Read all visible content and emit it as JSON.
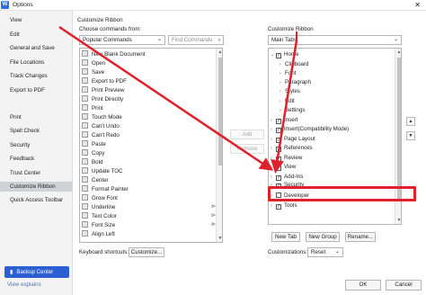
{
  "window": {
    "title": "Options",
    "logo": "W",
    "close_icon": "✕"
  },
  "sidebar": {
    "items": [
      {
        "label": "View"
      },
      {
        "label": "Edit"
      },
      {
        "label": "General and Save"
      },
      {
        "label": "File Locations"
      },
      {
        "label": "Track Changes"
      },
      {
        "label": "Export to PDF"
      },
      {
        "label": "Print"
      },
      {
        "label": "Spell Check"
      },
      {
        "label": "Security"
      },
      {
        "label": "Feedback"
      },
      {
        "label": "Trust Center"
      },
      {
        "label": "Customize Ribbon",
        "active": true
      },
      {
        "label": "Quick Access Toolbar"
      }
    ],
    "backup_label": "Backup Center",
    "view_explains": "View explains"
  },
  "left_panel": {
    "section_title": "Customize Ribbon",
    "choose_label": "Choose commands from:",
    "source_select": "Popular Commands",
    "search_placeholder": "Find Commands",
    "commands": [
      {
        "label": "New Blank Document",
        "icon": "new-doc-icon"
      },
      {
        "label": "Open",
        "icon": "open-icon"
      },
      {
        "label": "Save",
        "icon": "save-icon"
      },
      {
        "label": "Export to PDF",
        "icon": "pdf-icon"
      },
      {
        "label": "Print Preview",
        "icon": "print-preview-icon"
      },
      {
        "label": "Print  Directly",
        "icon": "print-directly-icon"
      },
      {
        "label": "Print",
        "icon": "print-icon"
      },
      {
        "label": "Touch Mode",
        "icon": "touch-icon"
      },
      {
        "label": "Can't Undo",
        "icon": "undo-icon"
      },
      {
        "label": "Can't Redo",
        "icon": "redo-icon"
      },
      {
        "label": "Paste",
        "icon": "paste-icon"
      },
      {
        "label": "Copy",
        "icon": "copy-icon"
      },
      {
        "label": "Bold",
        "icon": "bold-icon"
      },
      {
        "label": "Update  TOC",
        "icon": "toc-icon"
      },
      {
        "label": "Center",
        "icon": "center-icon"
      },
      {
        "label": "Format  Painter",
        "icon": "painter-icon"
      },
      {
        "label": "Grow Font",
        "icon": "grow-font-icon"
      },
      {
        "label": "Underline",
        "icon": "underline-icon",
        "submenu": true
      },
      {
        "label": "Text Color",
        "icon": "text-color-icon",
        "submenu": true
      },
      {
        "label": "Font Size",
        "icon": "font-size-icon",
        "submenu": true
      },
      {
        "label": "Align Left",
        "icon": "align-left-icon"
      }
    ],
    "keyboard_label": "Keyboard shortcuts:",
    "customize_button": "Customize..."
  },
  "middle": {
    "add_button": "Add",
    "remove_button": "Remove"
  },
  "right_panel": {
    "section_title": "Customize Ribbon",
    "tabs_select": "Main Tabs",
    "tree": [
      {
        "label": "Home",
        "expanded": true,
        "checked": true,
        "level": 0
      },
      {
        "label": "Clipboard",
        "level": 1
      },
      {
        "label": "Font",
        "level": 1
      },
      {
        "label": "Paragraph",
        "level": 1
      },
      {
        "label": "Styles",
        "level": 1
      },
      {
        "label": "Edit",
        "level": 1
      },
      {
        "label": "Settings",
        "level": 1
      },
      {
        "label": "Insert",
        "checked": true,
        "level": 0
      },
      {
        "label": "Insert(Compatibility Mode)",
        "checked": true,
        "level": 0
      },
      {
        "label": "Page Layout",
        "checked": true,
        "level": 0
      },
      {
        "label": "References",
        "checked": true,
        "level": 0
      },
      {
        "label": "Review",
        "checked": true,
        "level": 0
      },
      {
        "label": "View",
        "checked": true,
        "level": 0
      },
      {
        "label": "Add-Ins",
        "checked": true,
        "level": 0
      },
      {
        "label": "Security",
        "checked": true,
        "level": 0
      },
      {
        "label": "Developer",
        "checked": false,
        "level": 0,
        "highlighted": true
      },
      {
        "label": "Tools",
        "checked": true,
        "level": 0
      }
    ],
    "new_tab_button": "New Tab",
    "new_group_button": "New Group",
    "rename_button": "Rename...",
    "customizations_label": "Customizations:",
    "reset_select": "Reset"
  },
  "footer": {
    "ok_button": "OK",
    "cancel_button": "Cancel"
  },
  "colors": {
    "annotation_red": "#e0202a",
    "accent_blue": "#2c5fd1"
  }
}
